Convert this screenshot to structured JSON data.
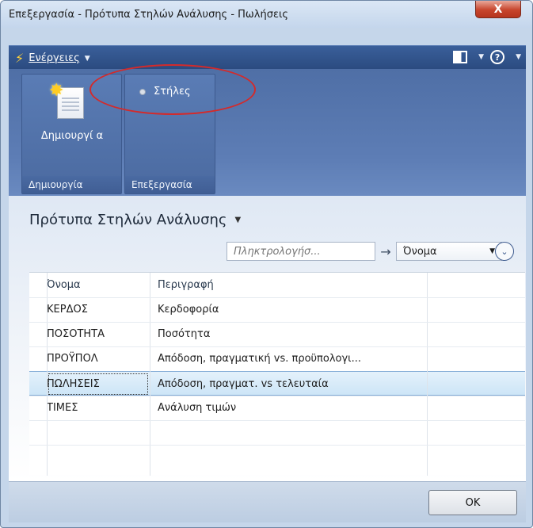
{
  "window": {
    "title": "Επεξεργασία - Πρότυπα Στηλών Ανάλυσης - Πωλήσεις",
    "close_glyph": "X"
  },
  "actionsbar": {
    "actions_label": "Ενέργειες",
    "actions_icon": "lightning-bolt-icon",
    "layout_icon": "layout-icon",
    "help_glyph": "?"
  },
  "ribbon": {
    "groups": [
      {
        "label": "Δημιουργία",
        "buttons": [
          {
            "label": "Δημιουργί α",
            "icon": "new-document-icon"
          }
        ]
      },
      {
        "label": "Επεξεργασία",
        "buttons": [
          {
            "label": "Στήλες",
            "icon": "bullet-icon"
          }
        ]
      }
    ]
  },
  "page": {
    "title": "Πρότυπα Στηλών Ανάλυσης",
    "filter": {
      "placeholder": "Πληκτρολογήσ...",
      "field_selected": "Όνομα"
    }
  },
  "grid": {
    "columns": [
      "Όνομα",
      "Περιγραφή"
    ],
    "rows": [
      {
        "name": "ΚΕΡΔΟΣ",
        "description": "Κερδοφορία"
      },
      {
        "name": "ΠΟΣΟΤΗΤΑ",
        "description": "Ποσότητα"
      },
      {
        "name": "ΠΡΟΫΠΟΛ",
        "description": "Απόδοση, πραγματική vs. προϋπολογι..."
      },
      {
        "name": "ΠΩΛΗΣΕΙΣ",
        "description": "Απόδοση, πραγματ. vs τελευταία",
        "selected": true
      },
      {
        "name": "ΤΙΜΕΣ",
        "description": "Ανάλυση τιμών"
      }
    ]
  },
  "footer": {
    "ok_label": "OK"
  },
  "colors": {
    "ribbon": "#4f6fa6",
    "selection": "#cde5f7",
    "annotation_ring": "#d42a2a"
  }
}
